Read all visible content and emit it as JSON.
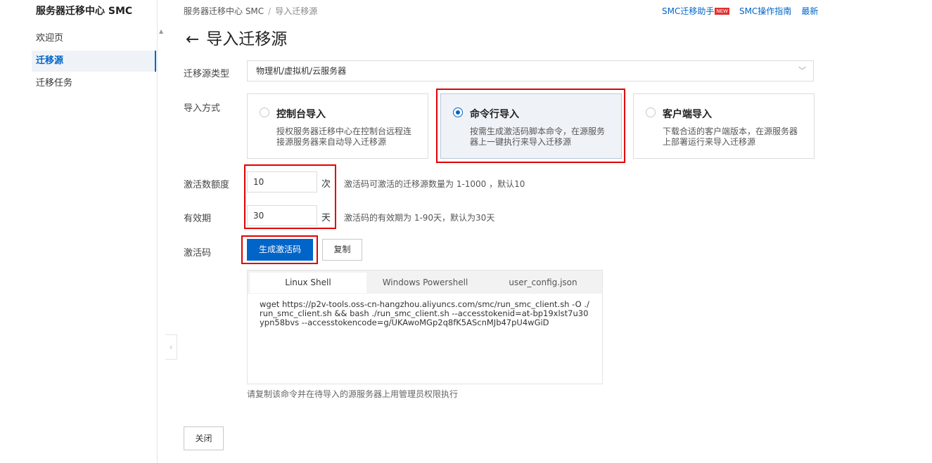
{
  "sidebar": {
    "title": "服务器迁移中心 SMC",
    "items": [
      {
        "label": "欢迎页"
      },
      {
        "label": "迁移源"
      },
      {
        "label": "迁移任务"
      }
    ]
  },
  "breadcrumb": {
    "root": "服务器迁移中心 SMC",
    "separator": "/",
    "current": "导入迁移源"
  },
  "top_links": {
    "assistant": "SMC迁移助手",
    "new_badge": "NEW",
    "guide": "SMC操作指南",
    "latest": "最新"
  },
  "page": {
    "back_arrow": "←",
    "title": "导入迁移源"
  },
  "form": {
    "source_type_label": "迁移源类型",
    "source_type_value": "物理机/虚拟机/云服务器",
    "import_method_label": "导入方式",
    "methods": [
      {
        "title": "控制台导入",
        "desc": "授权服务器迁移中心在控制台远程连接源服务器来自动导入迁移源"
      },
      {
        "title": "命令行导入",
        "desc": "按需生成激活码脚本命令，在源服务器上一键执行来导入迁移源"
      },
      {
        "title": "客户端导入",
        "desc": "下载合适的客户端版本，在源服务器上部署运行来导入迁移源"
      }
    ],
    "selected_method": "命令行导入",
    "quota_label": "激活数额度",
    "quota_value": "10",
    "quota_unit": "次",
    "quota_hint": "激活码可激活的迁移源数量为 1-1000 ，默认10",
    "validity_label": "有效期",
    "validity_value": "30",
    "validity_unit": "天",
    "validity_hint": "激活码的有效期为 1-90天，默认为30天",
    "code_label": "激活码",
    "generate_button": "生成激活码",
    "copy_button": "复制"
  },
  "code_panel": {
    "tabs": [
      "Linux Shell",
      "Windows Powershell",
      "user_config.json"
    ],
    "active_tab": "Linux Shell",
    "command": "wget https://p2v-tools.oss-cn-hangzhou.aliyuncs.com/smc/run_smc_client.sh -O ./run_smc_client.sh && bash ./run_smc_client.sh --accesstokenid=at-bp19xlst7u30ypn58bvs --accesstokencode=g/UKAwoMGp2q8fK5AScnMJb47pU4wGiD",
    "hint": "请复制该命令并在待导入的源服务器上用管理员权限执行"
  },
  "footer": {
    "close_button": "关闭"
  },
  "colors": {
    "accent": "#0064c8",
    "highlight_box": "#e00000",
    "selected_card_bg": "#eff3f8"
  }
}
